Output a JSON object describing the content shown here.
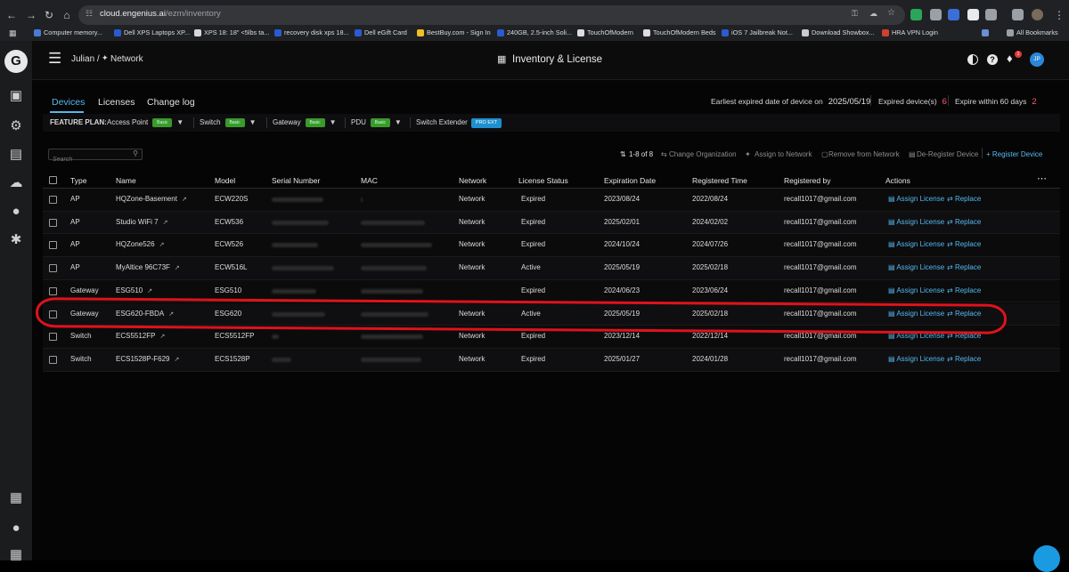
{
  "browser": {
    "url_host": "cloud.engenius.ai",
    "url_path": "/ezm/inventory",
    "bookmarks": [
      {
        "label": "Computer memory..."
      },
      {
        "label": "Dell XPS Laptops XP..."
      },
      {
        "label": "XPS 18: 18\" <5lbs ta..."
      },
      {
        "label": "recovery disk xps 18..."
      },
      {
        "label": "Dell eGift Card"
      },
      {
        "label": "BestBuy.com - Sign In"
      },
      {
        "label": "240GB, 2.5-inch Soli..."
      },
      {
        "label": "TouchOfModern"
      },
      {
        "label": "TouchOfModern Beds"
      },
      {
        "label": "iOS 7 Jailbreak Not..."
      },
      {
        "label": "Download Showbox..."
      },
      {
        "label": "HRA VPN Login"
      }
    ],
    "all_bookmarks": "All Bookmarks",
    "more": "»"
  },
  "header": {
    "breadcrumb_org": "Julian /",
    "breadcrumb_network": "Network",
    "page_title": "Inventory & License",
    "avatar_initials": "JP",
    "notification_count": "1"
  },
  "tabs": [
    "Devices",
    "Licenses",
    "Change log"
  ],
  "summary": {
    "earliest_label": "Earliest expired date of device on",
    "earliest_value": "2025/05/19",
    "expired_label": "Expired device(s)",
    "expired_value": "6",
    "expire60_label": "Expire within 60 days",
    "expire60_value": "2"
  },
  "feature_plan": {
    "label": "FEATURE PLAN:",
    "items": [
      {
        "name": "Access Point",
        "badge": "Basic"
      },
      {
        "name": "Switch",
        "badge": "Basic"
      },
      {
        "name": "Gateway",
        "badge": "Basic"
      },
      {
        "name": "PDU",
        "badge": "Basic"
      }
    ],
    "extender_label": "Switch Extender",
    "extender_badge": "PRO EXT"
  },
  "toolbar": {
    "search_placeholder": "Search",
    "pagination": "1-8 of 8",
    "change_org": "Change Organization",
    "assign_network": "Assign to Network",
    "remove_network": "Remove from Network",
    "deregister": "De-Register Device",
    "register": "+ Register Device"
  },
  "table": {
    "columns": [
      "Type",
      "Name",
      "Model",
      "Serial Number",
      "MAC",
      "Network",
      "License Status",
      "Expiration Date",
      "Registered Time",
      "Registered by",
      "Actions"
    ],
    "action_assign": "Assign License",
    "action_replace": "Replace",
    "rows": [
      {
        "type": "AP",
        "name": "HQZone-Basement",
        "model": "ECW220S",
        "network": "Network",
        "status": "Expired",
        "expiration": "2023/08/24",
        "registered": "2022/08/24",
        "by": "recall1017@gmail.com"
      },
      {
        "type": "AP",
        "name": "Studio WiFi 7",
        "model": "ECW536",
        "network": "Network",
        "status": "Expired",
        "expiration": "2025/02/01",
        "registered": "2024/02/02",
        "by": "recall1017@gmail.com"
      },
      {
        "type": "AP",
        "name": "HQZone526",
        "model": "ECW526",
        "network": "Network",
        "status": "Expired",
        "expiration": "2024/10/24",
        "registered": "2024/07/26",
        "by": "recall1017@gmail.com"
      },
      {
        "type": "AP",
        "name": "MyAltice 96C73F",
        "model": "ECW516L",
        "network": "Network",
        "status": "Active",
        "expiration": "2025/05/19",
        "registered": "2025/02/18",
        "by": "recall1017@gmail.com"
      },
      {
        "type": "Gateway",
        "name": "ESG510",
        "model": "ESG510",
        "network": "",
        "status": "Expired",
        "expiration": "2024/06/23",
        "registered": "2023/06/24",
        "by": "recall1017@gmail.com"
      },
      {
        "type": "Gateway",
        "name": "ESG620-FBDA",
        "model": "ESG620",
        "network": "Network",
        "status": "Active",
        "expiration": "2025/05/19",
        "registered": "2025/02/18",
        "by": "recall1017@gmail.com"
      },
      {
        "type": "Switch",
        "name": "ECS5512FP",
        "model": "ECS5512FP",
        "network": "Network",
        "status": "Expired",
        "expiration": "2023/12/14",
        "registered": "2022/12/14",
        "by": "recall1017@gmail.com"
      },
      {
        "type": "Switch",
        "name": "ECS1528P-F629",
        "model": "ECS1528P",
        "network": "Network",
        "status": "Expired",
        "expiration": "2025/01/27",
        "registered": "2024/01/28",
        "by": "recall1017@gmail.com"
      }
    ]
  }
}
